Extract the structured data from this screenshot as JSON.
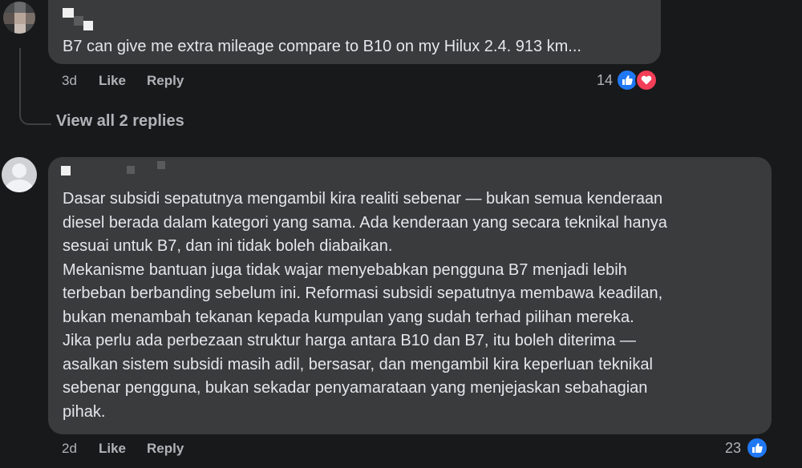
{
  "comment_1": {
    "text": "B7 can give me extra mileage compare to B10 on my Hilux 2.4. 913 km...",
    "time": "3d",
    "like_label": "Like",
    "reply_label": "Reply",
    "reaction_count": "14",
    "reactions": [
      "like-icon",
      "love-icon"
    ]
  },
  "view_replies_label": "View all 2 replies",
  "comment_2": {
    "lines": [
      "Dasar subsidi sepatutnya mengambil kira realiti sebenar — bukan semua kenderaan",
      "diesel berada dalam kategori yang sama. Ada kenderaan yang secara teknikal hanya",
      "sesuai untuk B7, dan ini tidak boleh diabaikan.",
      "Mekanisme bantuan juga tidak wajar menyebabkan pengguna B7 menjadi lebih",
      "terbeban berbanding sebelum ini. Reformasi subsidi sepatutnya membawa keadilan,",
      "bukan menambah tekanan kepada kumpulan yang sudah terhad pilihan mereka.",
      "Jika perlu ada perbezaan struktur harga antara B10 dan B7, itu boleh diterima —",
      "asalkan sistem subsidi masih adil, bersasar, dan mengambil kira keperluan teknikal",
      "sebenar pengguna, bukan sekadar penyamarataan yang menjejaskan sebahagian",
      "pihak."
    ],
    "time": "2d",
    "like_label": "Like",
    "reply_label": "Reply",
    "reaction_count": "23",
    "reactions": [
      "like-icon"
    ]
  },
  "colors": {
    "background": "#18191a",
    "bubble": "#3a3b3c",
    "text": "#e4e6eb",
    "secondary_text": "#b0b3b8",
    "like_blue": "#2078f4",
    "love_red": "#f33e58"
  }
}
